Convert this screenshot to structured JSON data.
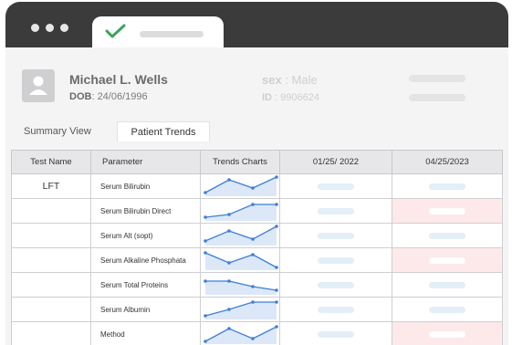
{
  "window": {
    "active_tab_icon": "check-icon"
  },
  "patient": {
    "name": "Michael L. Wells",
    "dob_label": "DOB",
    "dob": ": 24/06/1996",
    "sex_label": "sex",
    "sex": ": Male",
    "id_label": "ID",
    "id": ": 9906624"
  },
  "view_tabs": [
    "Summary View",
    "Patient Trends"
  ],
  "table": {
    "headers": [
      "Test Name",
      "Parameter",
      "Trends Charts",
      "01/25/ 2022",
      "04/25/2023"
    ],
    "rows": [
      {
        "test": "LFT",
        "parameter": "Serum Bilirubin",
        "trend": [
          0.15,
          0.85,
          0.4,
          1.0
        ],
        "flag": false
      },
      {
        "test": "",
        "parameter": "Serum Bilirubin Direct",
        "trend": [
          0.15,
          0.3,
          0.85,
          0.85
        ],
        "flag": true
      },
      {
        "test": "",
        "parameter": "Serum Alt (sopt)",
        "trend": [
          0.2,
          0.75,
          0.3,
          1.0
        ],
        "flag": false
      },
      {
        "test": "",
        "parameter": "Serum Alkaline Phosphata",
        "trend": [
          0.9,
          0.35,
          0.8,
          0.1
        ],
        "flag": true
      },
      {
        "test": "",
        "parameter": "Serum Total Proteins",
        "trend": [
          0.7,
          0.7,
          0.4,
          0.2
        ],
        "flag": false
      },
      {
        "test": "",
        "parameter": "Serum Albumin",
        "trend": [
          0.15,
          0.5,
          0.9,
          0.9
        ],
        "flag": false
      },
      {
        "test": "",
        "parameter": "Method",
        "trend": [
          0.1,
          0.8,
          0.25,
          0.9
        ],
        "flag": true
      }
    ]
  },
  "colors": {
    "accent": "#3f7fd6",
    "flag": "#fde9ea",
    "check": "#3aa35a"
  }
}
